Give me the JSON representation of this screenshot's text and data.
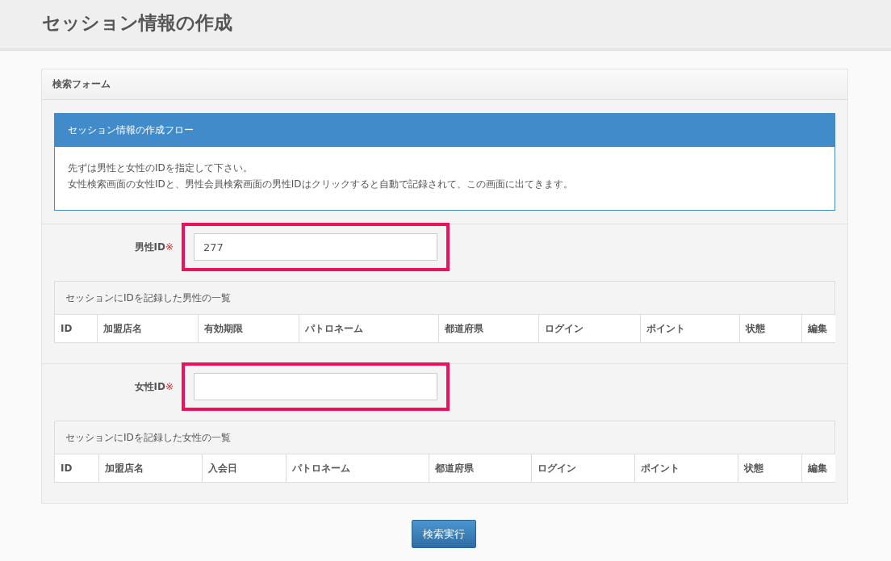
{
  "page_title": "セッション情報の作成",
  "panel": {
    "title": "検索フォーム",
    "info_box": {
      "title": "セッション情報の作成フロー",
      "lines": [
        "先ずは男性と女性のIDを指定して下さい。",
        "女性検索画面の女性IDと、男性会員検索画面の男性IDはクリックすると自動で記録されて、この画面に出てきます。"
      ]
    },
    "sections": [
      {
        "label": "男性ID",
        "required_mark": "※",
        "value": "277",
        "highlighted": true,
        "table": {
          "caption": "セッションにIDを記録した男性の一覧",
          "columns": [
            "ID",
            "加盟店名",
            "有効期限",
            "パトロネーム",
            "都道府県",
            "ログイン",
            "ポイント",
            "状態",
            "編集"
          ]
        }
      },
      {
        "label": "女性ID",
        "required_mark": "※",
        "highlighted": true,
        "table": {
          "caption": "セッションにIDを記録した女性の一覧",
          "columns": [
            "ID",
            "加盟店名",
            "入会日",
            "パトロネーム",
            "都道府県",
            "ログイン",
            "ポイント",
            "状態",
            "編集"
          ]
        }
      }
    ]
  },
  "submit_button": "検索実行"
}
